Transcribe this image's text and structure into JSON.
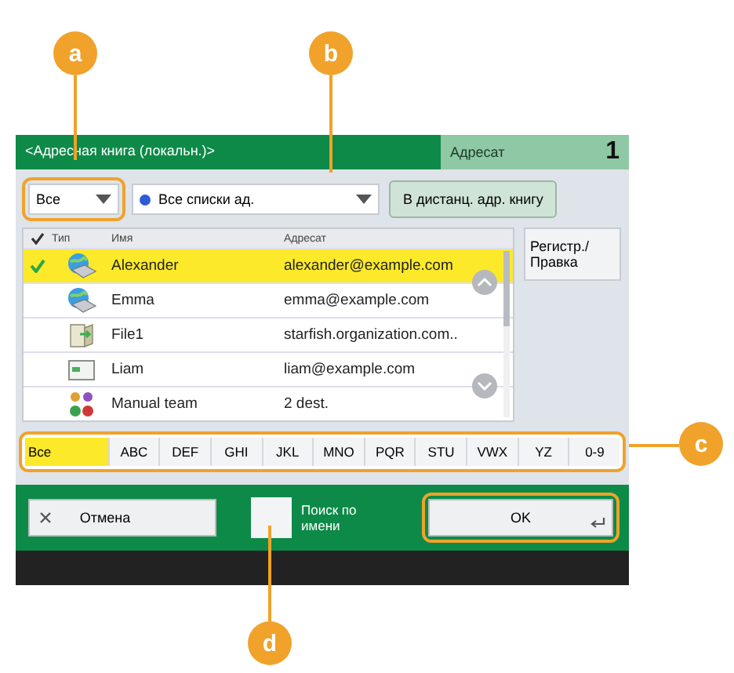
{
  "header": {
    "title": "<Адресная книга (локальн.)>",
    "destination_label": "Адресат",
    "destination_count": "1"
  },
  "filters": {
    "type_dropdown": "Все",
    "list_dropdown": "Все списки ад.",
    "remote_button": "В дистанц. адр. книгу"
  },
  "table": {
    "columns": [
      "Тип",
      "Имя",
      "Адресат"
    ],
    "rows": [
      {
        "kind": "email",
        "name": "Alexander",
        "address": "alexander@example.com",
        "selected": true,
        "checked": true
      },
      {
        "kind": "email",
        "name": "Emma",
        "address": "emma@example.com",
        "selected": false,
        "checked": false
      },
      {
        "kind": "file",
        "name": "File1",
        "address": "starfish.organization.com..",
        "selected": false,
        "checked": false
      },
      {
        "kind": "fax",
        "name": "Liam",
        "address": "liam@example.com",
        "selected": false,
        "checked": false
      },
      {
        "kind": "group",
        "name": "Manual team",
        "address": "2 dest.",
        "selected": false,
        "checked": false
      }
    ]
  },
  "edit_button": "Регистр./\nПравка",
  "alphabet": [
    {
      "label": "Все",
      "selected": true
    },
    {
      "label": "ABC",
      "selected": false
    },
    {
      "label": "DEF",
      "selected": false
    },
    {
      "label": "GHI",
      "selected": false
    },
    {
      "label": "JKL",
      "selected": false
    },
    {
      "label": "MNO",
      "selected": false
    },
    {
      "label": "PQR",
      "selected": false
    },
    {
      "label": "STU",
      "selected": false
    },
    {
      "label": "VWX",
      "selected": false
    },
    {
      "label": "YZ",
      "selected": false
    },
    {
      "label": "0-9",
      "selected": false
    }
  ],
  "footer": {
    "cancel": "Отмена",
    "name_search": {
      "label": "Поиск по\nимени",
      "checked": false
    },
    "ok": "OK"
  },
  "callouts": [
    {
      "label": "a"
    },
    {
      "label": "b"
    },
    {
      "label": "c"
    },
    {
      "label": "d"
    }
  ]
}
